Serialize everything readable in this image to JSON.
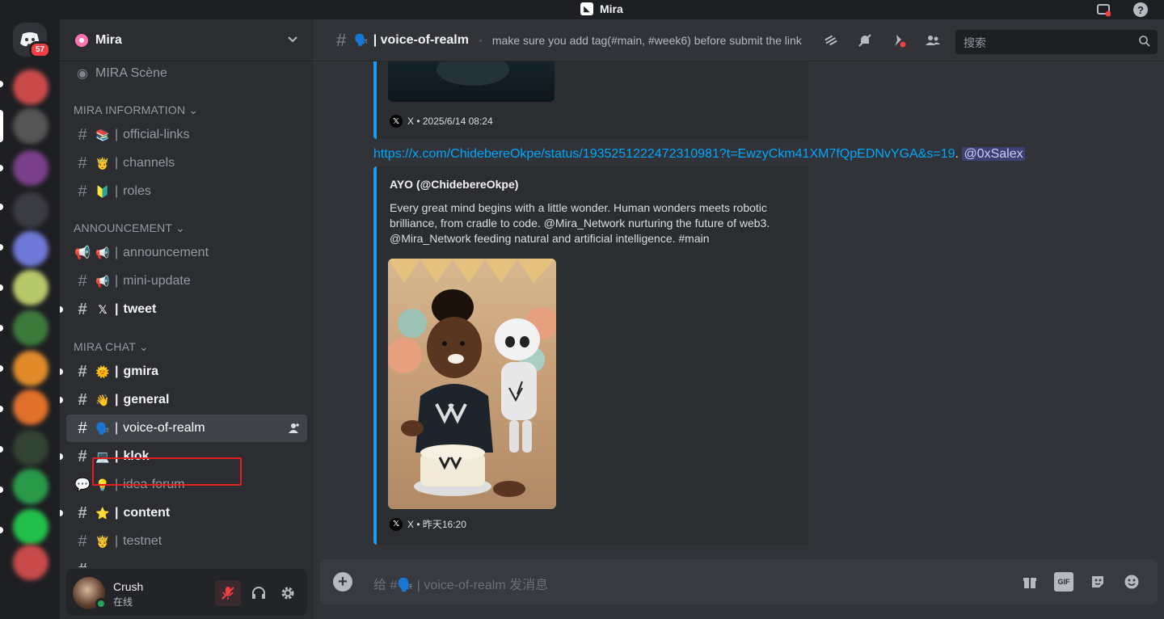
{
  "titlebar": {
    "app_name": "Mira",
    "logo_glyph": "◣"
  },
  "rail": {
    "home_badge": "57"
  },
  "guild": {
    "name": "Mira"
  },
  "sidebar": {
    "top_item": {
      "label": "MIRA Scène"
    },
    "categories": {
      "info": "MIRA INFORMATION",
      "announcement": "ANNOUNCEMENT",
      "chat": "MIRA CHAT"
    },
    "channels": [
      {
        "emoji": "📚",
        "label": "official-links"
      },
      {
        "emoji": "🤴",
        "label": "channels"
      },
      {
        "emoji": "🔰",
        "label": "roles"
      },
      {
        "emoji": "📢",
        "label": "announcement"
      },
      {
        "emoji": "📢",
        "label": "mini-update"
      },
      {
        "emoji": "𝕏",
        "label": "tweet"
      },
      {
        "emoji": "🌞",
        "label": "gmira"
      },
      {
        "emoji": "👋",
        "label": "general"
      },
      {
        "emoji": "🗣️",
        "label": "voice-of-realm"
      },
      {
        "emoji": "💻",
        "label": "klok"
      },
      {
        "emoji": "💡",
        "label": "idea-forum"
      },
      {
        "emoji": "⭐",
        "label": "content"
      },
      {
        "emoji": "🤴",
        "label": "testnet"
      }
    ],
    "separator": "|"
  },
  "user": {
    "name": "Crush",
    "status": "在线"
  },
  "header": {
    "channel_emoji": "🗣️",
    "channel_name": "| voice-of-realm",
    "topic": "make sure you add tag(#main, #week6) before submit the link",
    "search_placeholder": "搜索"
  },
  "messages": {
    "embed1_footer": "X • 2025/6/14 08:24",
    "link": "https://x.com/ChidebereOkpe/status/1935251222472310981?t=EwzyCkm41XM7fQpEDNvYGA&s=19",
    "link_suffix": ".",
    "mention": "@0xSalex",
    "embed2": {
      "author": "AYO (@ChidebereOkpe)",
      "description": "Every great mind begins with a little wonder. Human wonders meets robotic brilliance, from cradle to code. @Mira_Network nurturing the future of web3. @Mira_Network feeding natural and artificial intelligence. #main",
      "footer": "X • 昨天16:20"
    }
  },
  "composer": {
    "placeholder": "给 #🗣️ | voice-of-realm 发消息",
    "gif_label": "GIF"
  },
  "colors": {
    "accent": "#5865f2",
    "twitter_bar": "#1d9bf0",
    "highlight": "#e02020",
    "online": "#23a55a"
  }
}
